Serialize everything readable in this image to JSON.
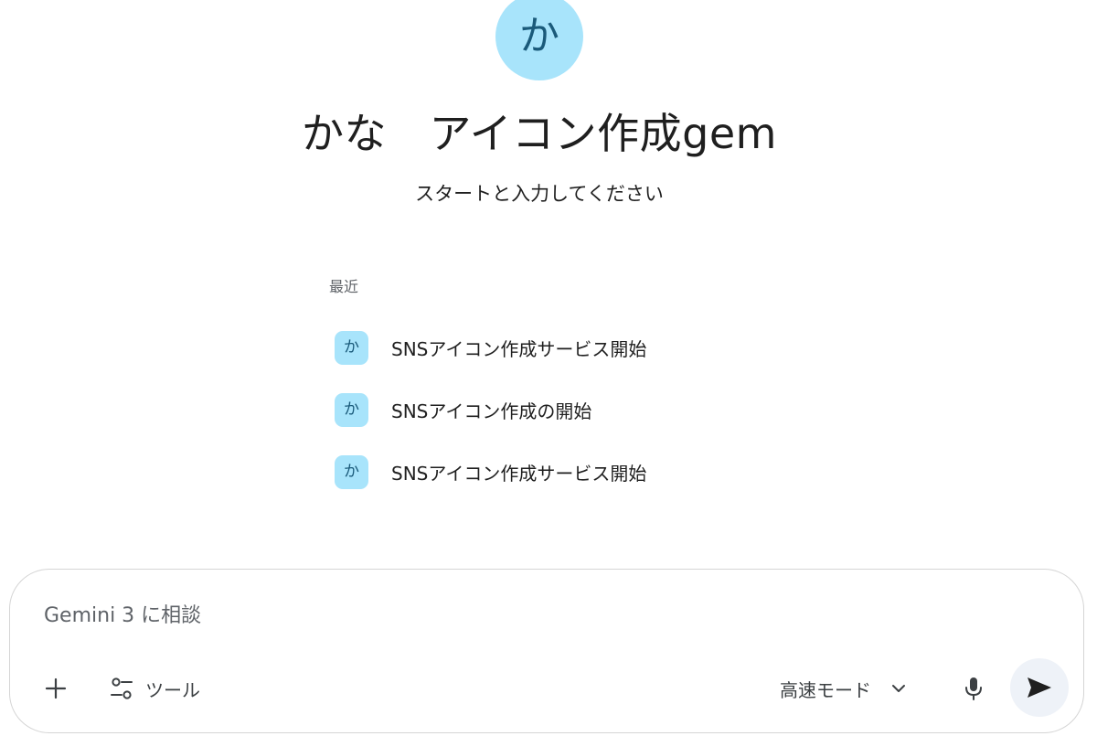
{
  "gem": {
    "avatar_initial": "か",
    "title": "かな　アイコン作成gem",
    "subtitle": "スタートと入力してください"
  },
  "recent": {
    "heading": "最近",
    "items": [
      {
        "icon": "か",
        "label": "SNSアイコン作成サービス開始"
      },
      {
        "icon": "か",
        "label": "SNSアイコン作成の開始"
      },
      {
        "icon": "か",
        "label": "SNSアイコン作成サービス開始"
      }
    ]
  },
  "composer": {
    "placeholder": "Gemini 3 に相談",
    "value": "",
    "tools_label": "ツール",
    "mode_label": "高速モード",
    "icons": {
      "add": "plus-icon",
      "tools": "tune-icon",
      "mode": "chevron-down-icon",
      "mic": "microphone-icon",
      "send": "send-icon"
    }
  },
  "colors": {
    "avatar_bg": "#a8e4fb",
    "avatar_text": "#1a5a7a",
    "send_bg": "#eef2f8",
    "border": "#d5d5d5"
  }
}
